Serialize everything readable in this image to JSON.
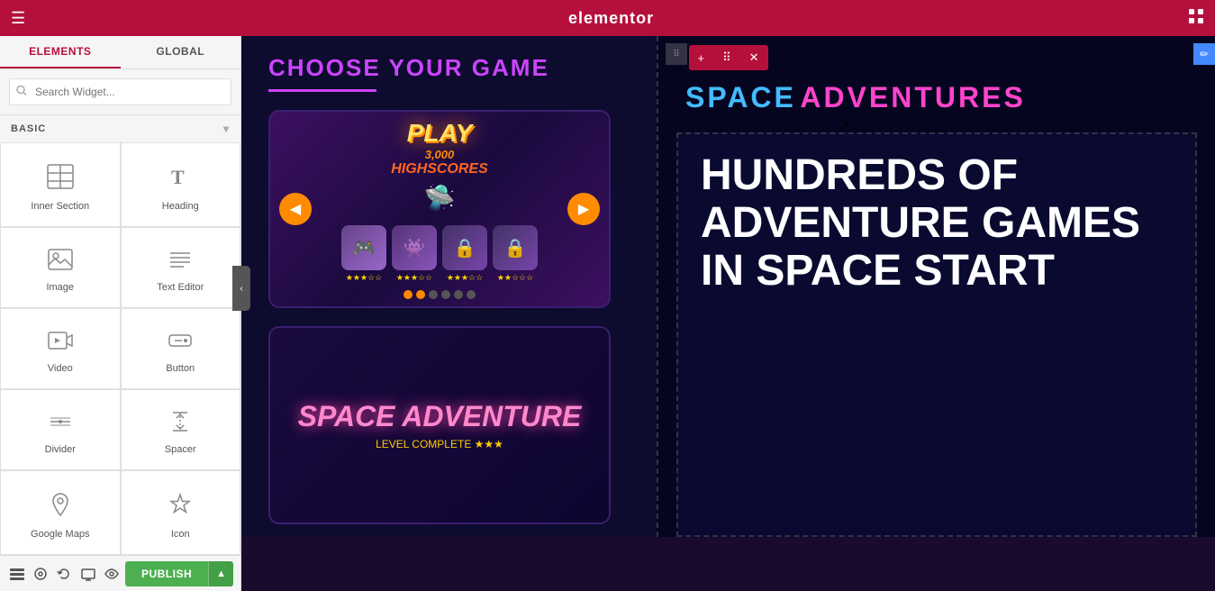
{
  "topbar": {
    "logo": "elementor",
    "hamburger": "☰",
    "grid": "⊞"
  },
  "sidebar": {
    "tab_elements": "ELEMENTS",
    "tab_global": "GLOBAL",
    "search_placeholder": "Search Widget...",
    "category": "BASIC",
    "widgets": [
      {
        "id": "inner-section",
        "icon": "inner_section",
        "label": "Inner Section"
      },
      {
        "id": "heading",
        "icon": "heading",
        "label": "Heading"
      },
      {
        "id": "image",
        "icon": "image",
        "label": "Image"
      },
      {
        "id": "text-editor",
        "icon": "text_editor",
        "label": "Text Editor"
      },
      {
        "id": "video",
        "icon": "video",
        "label": "Video"
      },
      {
        "id": "button",
        "icon": "button",
        "label": "Button"
      },
      {
        "id": "divider",
        "icon": "divider",
        "label": "Divider"
      },
      {
        "id": "spacer",
        "icon": "spacer",
        "label": "Spacer"
      },
      {
        "id": "google-maps",
        "icon": "google_maps",
        "label": "Google Maps"
      },
      {
        "id": "icon",
        "icon": "icon",
        "label": "Icon"
      }
    ]
  },
  "bottom_toolbar": {
    "tools": [
      "layers",
      "styles",
      "history",
      "responsive",
      "preview"
    ],
    "publish_label": "PUBLISH",
    "publish_arrow": "▲"
  },
  "canvas": {
    "section_toolbar": {
      "add": "+",
      "move": "⋮⋮",
      "close": "✕"
    },
    "left": {
      "game_title": "CHOOSE YOUR GAME",
      "card1": {
        "play_text": "PLAY",
        "number_text": "3,000",
        "highscores_text": "HIGHSCORES"
      }
    },
    "right": {
      "space_label": "SPACE",
      "adventures_label": "ADVENTURES",
      "big_text": "HUNDREDS OF ADVENTURE GAMES IN SPACE START"
    }
  }
}
